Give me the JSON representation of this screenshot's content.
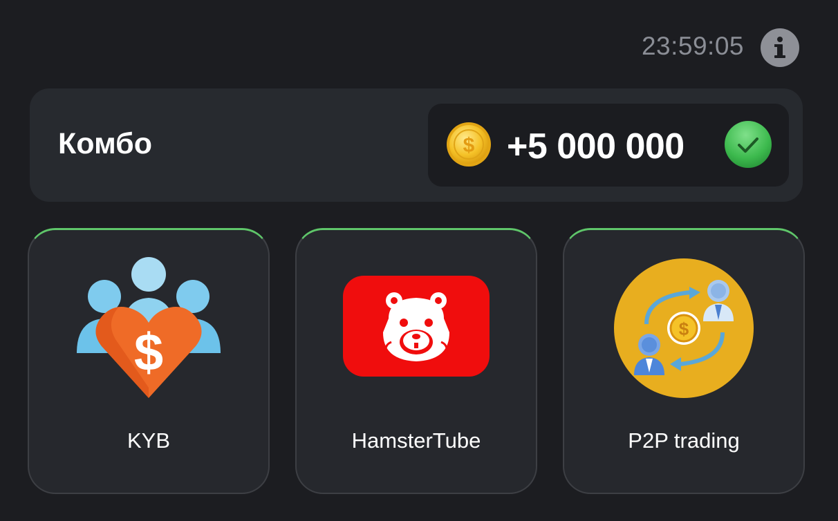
{
  "header": {
    "timer": "23:59:05",
    "info_icon": "info-icon"
  },
  "combo": {
    "title": "Комбо",
    "reward": "+5 000 000",
    "coin_icon": "dollar-coin-icon",
    "status_icon": "check-icon",
    "status_color": "#3dba4e"
  },
  "cards": [
    {
      "label": "KYB",
      "icon": "people-heart-dollar-icon"
    },
    {
      "label": "HamsterTube",
      "icon": "hamster-video-play-icon"
    },
    {
      "label": "P2P trading",
      "icon": "p2p-exchange-icon"
    }
  ],
  "colors": {
    "background": "#1c1d21",
    "panel": "#272a2f",
    "card_border_accent": "#5fc66a",
    "timer_text": "#8b8e96"
  }
}
